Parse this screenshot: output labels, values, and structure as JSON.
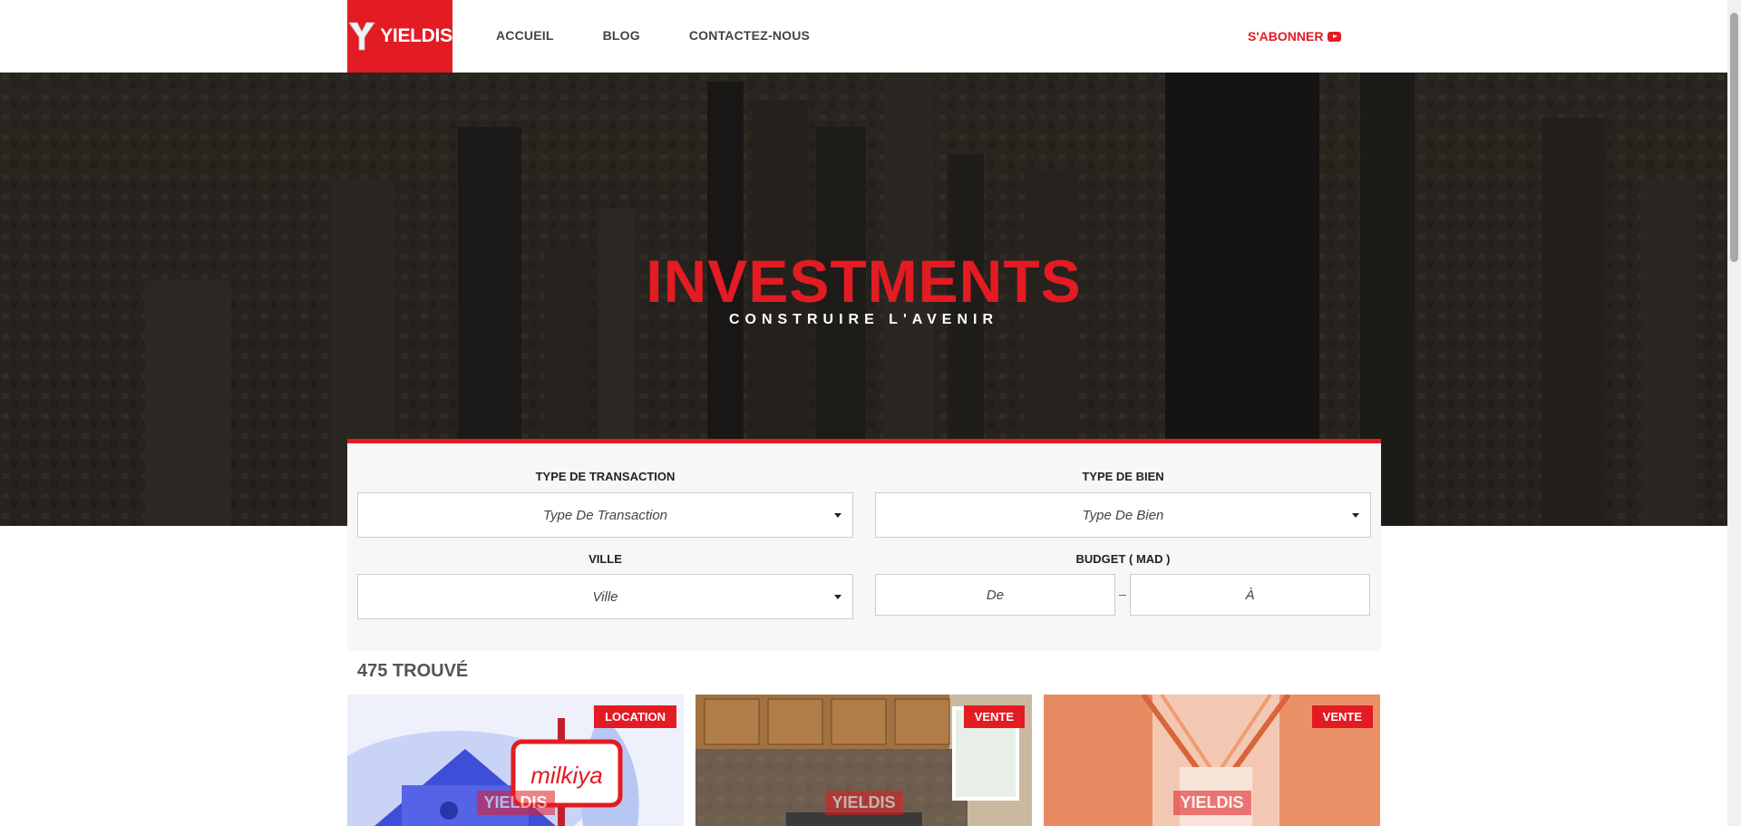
{
  "header": {
    "logo_text": "YIELDIS",
    "nav": [
      "ACCUEIL",
      "BLOG",
      "CONTACTEZ-NOUS"
    ],
    "subscribe_label": "S'ABONNER"
  },
  "hero": {
    "title": "INVESTMENTS",
    "subtitle": "CONSTRUIRE L'AVENIR"
  },
  "search": {
    "transaction": {
      "label": "TYPE DE TRANSACTION",
      "value": "Type De Transaction"
    },
    "property": {
      "label": "TYPE DE BIEN",
      "value": "Type De Bien"
    },
    "city": {
      "label": "VILLE",
      "value": "Ville"
    },
    "budget": {
      "label": "BUDGET ( MAD )",
      "from_placeholder": "De",
      "to_placeholder": "À",
      "separator": "–"
    }
  },
  "results": {
    "count_text": "475 TROUVÉ",
    "cards": [
      {
        "badge": "LOCATION",
        "image_text": "milkiya",
        "watermark": "YIELDIS"
      },
      {
        "badge": "VENTE",
        "watermark": "YIELDIS"
      },
      {
        "badge": "VENTE",
        "watermark": "YIELDIS"
      }
    ]
  },
  "colors": {
    "brand_red": "#e31b23",
    "nav_text": "#444444",
    "panel_bg": "#f7f7f7"
  }
}
